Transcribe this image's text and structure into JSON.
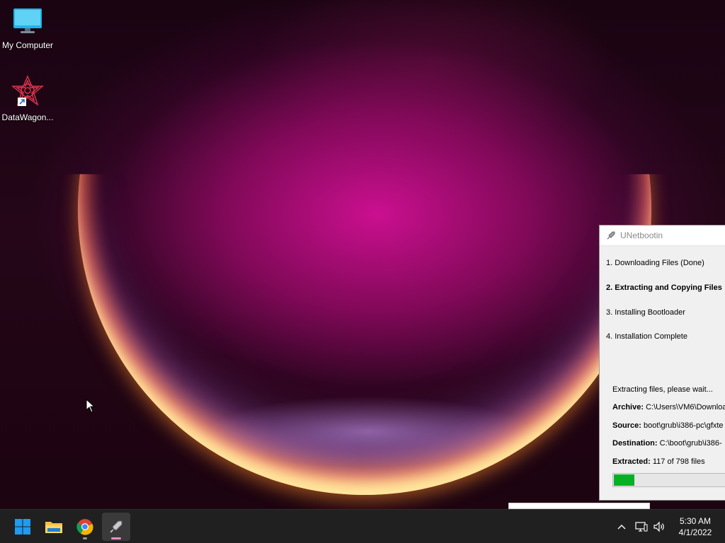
{
  "desktop": {
    "icons": [
      {
        "label": "My Computer",
        "icon": "monitor-icon"
      },
      {
        "label": "DataWagon...",
        "icon": "datawagon-app-icon"
      }
    ]
  },
  "unetbootin": {
    "title": "UNetbootin",
    "steps": [
      {
        "label": "1. Downloading Files (Done)",
        "active": false
      },
      {
        "label": "2. Extracting and Copying Files",
        "active": true
      },
      {
        "label": "3. Installing Bootloader",
        "active": false
      },
      {
        "label": "4. Installation Complete",
        "active": false
      }
    ],
    "status": "Extracting files, please wait...",
    "archive_label": "Archive:",
    "archive_value": "C:\\Users\\VM6\\Downloa",
    "source_label": "Source:",
    "source_value": "boot\\grub\\i386-pc\\gfxte",
    "destination_label": "Destination:",
    "destination_value": "C:\\boot\\grub\\i386-",
    "extracted_label": "Extracted:",
    "extracted_value": "117 of 798 files",
    "progress_fraction": 0.147,
    "progress_color": "#06b025"
  },
  "taskbar": {
    "apps": [
      {
        "name": "start-button",
        "icon": "windows-logo-icon"
      },
      {
        "name": "file-explorer",
        "icon": "folder-icon"
      },
      {
        "name": "chrome",
        "icon": "chrome-icon"
      },
      {
        "name": "unetbootin",
        "icon": "unetbootin-icon"
      }
    ],
    "tray": [
      "chevron-up-icon",
      "network-icon",
      "volume-icon"
    ],
    "time": "5:30 AM",
    "date": "4/1/2022"
  },
  "colors": {
    "taskbar_bg": "#202020",
    "accent_blue": "#1f9bf0",
    "wallpaper_magenta": "#d41096"
  }
}
